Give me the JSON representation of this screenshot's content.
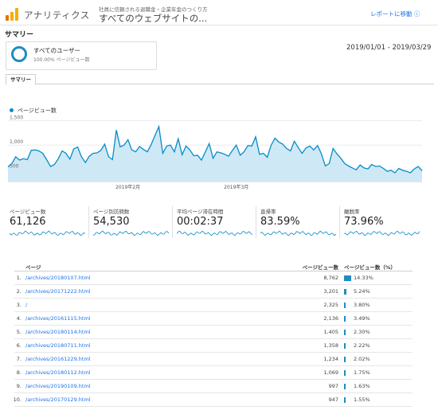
{
  "header": {
    "app_name": "アナリティクス",
    "site_subtitle": "社員に信頼される退職金・企業年金のつくり方",
    "site_title": "すべてのウェブサイトの...",
    "report_link": "レポートに移動 ⓘ"
  },
  "summary_title": "サマリー",
  "segment": {
    "label": "すべてのユーザー",
    "sub": "100.00% ページビュー数"
  },
  "date_range": "2019/01/01 - 2019/03/29",
  "tabs": [
    "サマリー"
  ],
  "chart_data": {
    "type": "area",
    "series": [
      {
        "name": "ページビュー数",
        "values": [
          550,
          620,
          760,
          690,
          720,
          700,
          890,
          900,
          880,
          830,
          700,
          560,
          600,
          720,
          880,
          830,
          710,
          920,
          960,
          760,
          640,
          770,
          830,
          840,
          890,
          1020,
          760,
          700,
          1310,
          960,
          1000,
          1110,
          900,
          860,
          970,
          910,
          860,
          1010,
          1200,
          1380,
          830,
          980,
          1000,
          860,
          1130,
          800,
          980,
          900,
          780,
          790,
          690,
          860,
          1030,
          730,
          860,
          840,
          810,
          770,
          890,
          1000,
          790,
          860,
          990,
          980,
          1170,
          810,
          830,
          750,
          1000,
          1140,
          1060,
          1020,
          930,
          880,
          1080,
          950,
          830,
          940,
          980,
          900,
          990,
          820,
          570,
          620,
          930,
          820,
          730,
          620,
          570,
          530,
          490,
          590,
          530,
          510,
          600,
          560,
          570,
          520,
          460,
          480,
          430,
          520,
          480,
          460,
          430,
          510,
          560,
          470
        ]
      }
    ],
    "x_ticks": [
      "2019年2月",
      "2019年3月"
    ],
    "y_ticks": [
      "1,500",
      "1,000",
      "500"
    ],
    "ylim": [
      250,
      1560
    ],
    "color": "#058dc7"
  },
  "kpis": [
    {
      "label": "ページビュー数",
      "value": "61,126"
    },
    {
      "label": "ページ別訪問数",
      "value": "54,530"
    },
    {
      "label": "平均ページ滞在時間",
      "value": "00:02:37"
    },
    {
      "label": "直帰率",
      "value": "83.59%"
    },
    {
      "label": "離脱率",
      "value": "73.96%"
    }
  ],
  "table": {
    "headers": {
      "page": "ページ",
      "pageviews": "ページビュー数",
      "pct": "ページビュー数（%）"
    },
    "rows": [
      {
        "idx": "1.",
        "page": "/archives/20180107.html",
        "pageviews": "8,762",
        "pct": "14.33%",
        "share": 14.33
      },
      {
        "idx": "2.",
        "page": "/archives/20171222.html",
        "pageviews": "3,201",
        "pct": "5.24%",
        "share": 5.24
      },
      {
        "idx": "3.",
        "page": "/",
        "pageviews": "2,325",
        "pct": "3.80%",
        "share": 3.8
      },
      {
        "idx": "4.",
        "page": "/archives/20161115.html",
        "pageviews": "2,136",
        "pct": "3.49%",
        "share": 3.49
      },
      {
        "idx": "5.",
        "page": "/archives/20180114.html",
        "pageviews": "1,405",
        "pct": "2.30%",
        "share": 2.3
      },
      {
        "idx": "6.",
        "page": "/archives/20180711.html",
        "pageviews": "1,358",
        "pct": "2.22%",
        "share": 2.22
      },
      {
        "idx": "7.",
        "page": "/archives/20161229.html",
        "pageviews": "1,234",
        "pct": "2.02%",
        "share": 2.02
      },
      {
        "idx": "8.",
        "page": "/archives/20180112.html",
        "pageviews": "1,069",
        "pct": "1.75%",
        "share": 1.75
      },
      {
        "idx": "9.",
        "page": "/archives/20190109.html",
        "pageviews": "997",
        "pct": "1.63%",
        "share": 1.63
      },
      {
        "idx": "10.",
        "page": "/archives/20170129.html",
        "pageviews": "947",
        "pct": "1.55%",
        "share": 1.55
      }
    ]
  }
}
